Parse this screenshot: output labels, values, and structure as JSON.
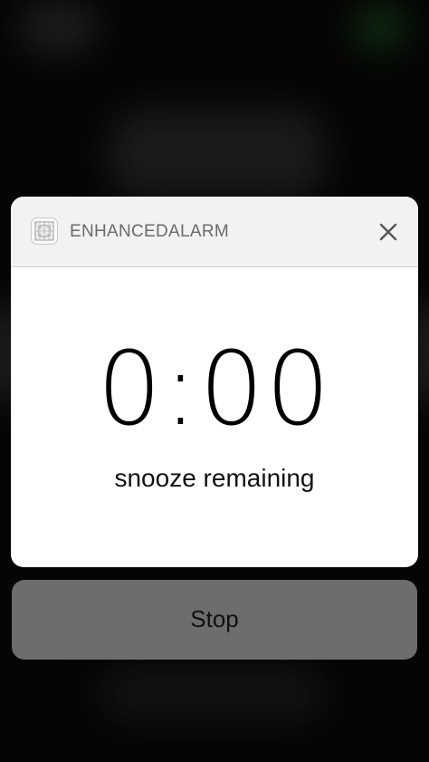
{
  "notification": {
    "app_name": "ENHANCEDALARM",
    "app_icon": "grid-icon",
    "close_icon": "close-icon",
    "timer_value": "0:00",
    "timer_caption": "snooze remaining"
  },
  "actions": {
    "stop_label": "Stop"
  },
  "colors": {
    "card_background": "#ffffff",
    "header_background": "#f2f2f2",
    "stop_button_background": "#6d6d6d",
    "screen_background": "#050505"
  }
}
